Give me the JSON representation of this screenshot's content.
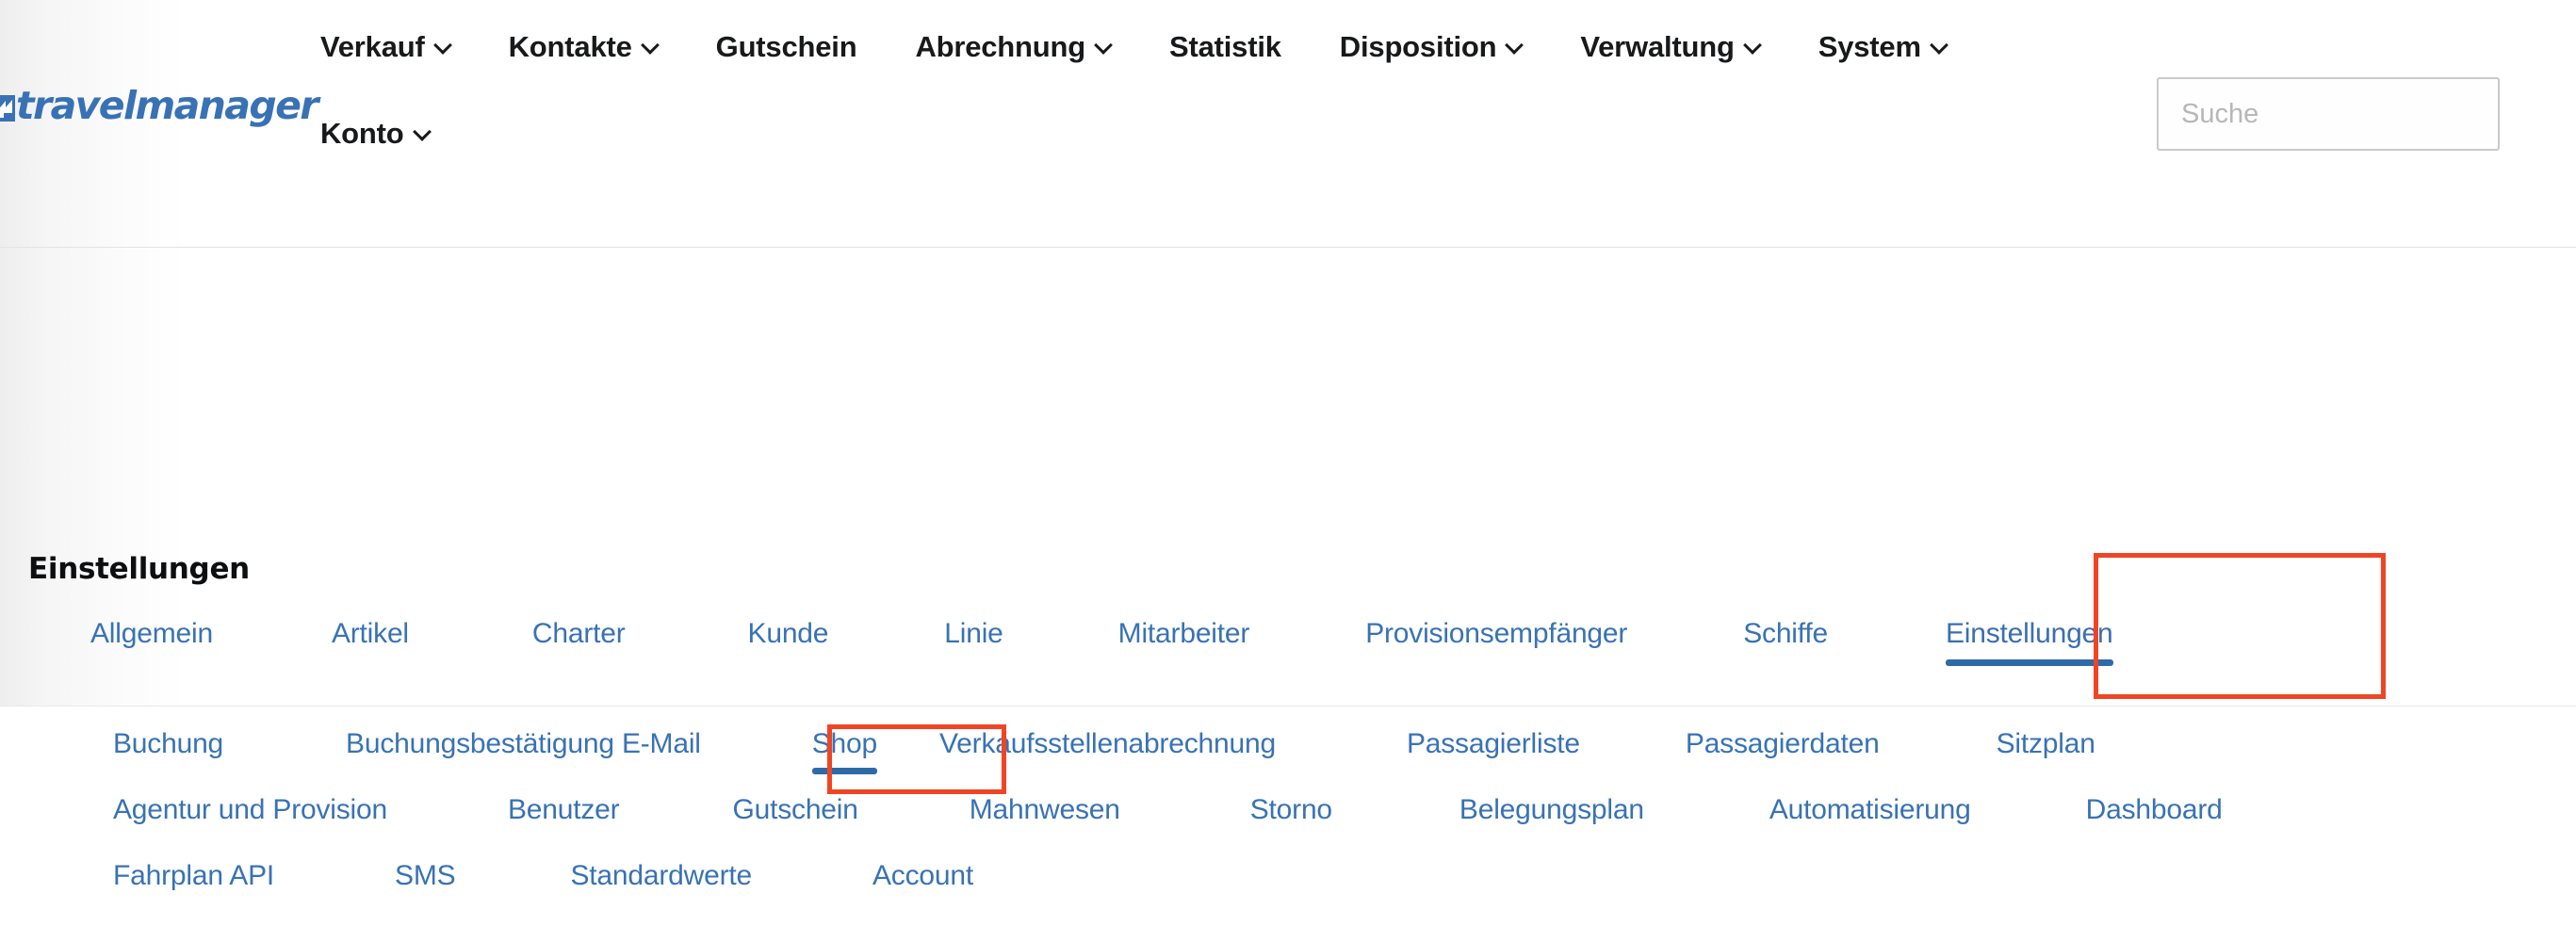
{
  "brand": {
    "name": "travelmanager",
    "mark_icon": "travelmanager-logo-mark",
    "color": "#3872b5"
  },
  "header": {
    "nav_row_1": [
      {
        "label": "Verkauf",
        "has_caret": true
      },
      {
        "label": "Kontakte",
        "has_caret": true
      },
      {
        "label": "Gutschein",
        "has_caret": false
      },
      {
        "label": "Abrechnung",
        "has_caret": true
      },
      {
        "label": "Statistik",
        "has_caret": false
      },
      {
        "label": "Disposition",
        "has_caret": true
      },
      {
        "label": "Verwaltung",
        "has_caret": true
      },
      {
        "label": "System",
        "has_caret": true
      }
    ],
    "nav_row_2": [
      {
        "label": "Konto",
        "has_caret": true
      }
    ],
    "search": {
      "placeholder": "Suche",
      "value": ""
    }
  },
  "main": {
    "page_title": "Einstellungen",
    "tabs": [
      {
        "label": "Allgemein",
        "active": false
      },
      {
        "label": "Artikel",
        "active": false
      },
      {
        "label": "Charter",
        "active": false
      },
      {
        "label": "Kunde",
        "active": false
      },
      {
        "label": "Linie",
        "active": false
      },
      {
        "label": "Mitarbeiter",
        "active": false
      },
      {
        "label": "Provisionsempfänger",
        "active": false
      },
      {
        "label": "Schiffe",
        "active": false
      },
      {
        "label": "Einstellungen",
        "active": true
      }
    ],
    "subtab_rows": [
      [
        {
          "label": "Buchung",
          "active": false
        },
        {
          "label": "Buchungsbestätigung E-Mail",
          "active": false
        },
        {
          "label": "Shop",
          "active": true
        },
        {
          "label": "Verkaufsstellenabrechnung",
          "active": false
        },
        {
          "label": "Passagierliste",
          "active": false
        },
        {
          "label": "Passagierdaten",
          "active": false
        },
        {
          "label": "Sitzplan",
          "active": false
        }
      ],
      [
        {
          "label": "Agentur und Provision",
          "active": false
        },
        {
          "label": "Benutzer",
          "active": false
        },
        {
          "label": "Gutschein",
          "active": false
        },
        {
          "label": "Mahnwesen",
          "active": false
        },
        {
          "label": "Storno",
          "active": false
        },
        {
          "label": "Belegungsplan",
          "active": false
        },
        {
          "label": "Automatisierung",
          "active": false
        },
        {
          "label": "Dashboard",
          "active": false
        }
      ],
      [
        {
          "label": "Fahrplan API",
          "active": false
        },
        {
          "label": "SMS",
          "active": false
        },
        {
          "label": "Standardwerte",
          "active": false
        },
        {
          "label": "Account",
          "active": false
        }
      ]
    ],
    "annotations": [
      {
        "target": "Einstellungen",
        "color": "#f04524"
      },
      {
        "target": "Shop",
        "color": "#f04524"
      }
    ],
    "accent_color": "#3872b5",
    "active_underline_color": "#2e6aa8"
  }
}
